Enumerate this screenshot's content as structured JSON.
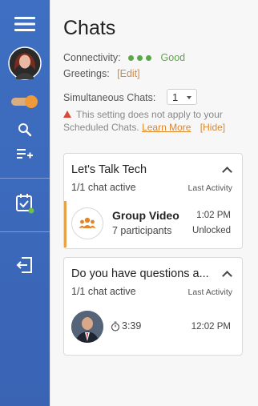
{
  "sidebar": {
    "toggle_state": "on"
  },
  "main": {
    "title": "Chats",
    "connectivity": {
      "label": "Connectivity:",
      "status": "Good"
    },
    "greetings": {
      "label": "Greetings:",
      "action": "[Edit]"
    },
    "simultaneous": {
      "label": "Simultaneous Chats:",
      "value": "1"
    },
    "warning": {
      "text": "This setting does not apply to your Scheduled Chats.",
      "learn_more": "Learn More",
      "hide": "[Hide]"
    }
  },
  "cards": [
    {
      "title": "Let's Talk Tech",
      "active": "1/1 chat active",
      "last_activity_label": "Last Activity",
      "chat": {
        "name": "Group Video",
        "sub": "7 participants",
        "time": "1:02 PM",
        "status": "Unlocked"
      }
    },
    {
      "title": "Do you have questions a...",
      "active": "1/1 chat active",
      "last_activity_label": "Last Activity",
      "chat": {
        "timer": "3:39",
        "time": "12:02 PM"
      }
    }
  ],
  "colors": {
    "sidebar": "#3e6fc2",
    "accent_orange": "#e0862a",
    "good_green": "#5aa846"
  }
}
